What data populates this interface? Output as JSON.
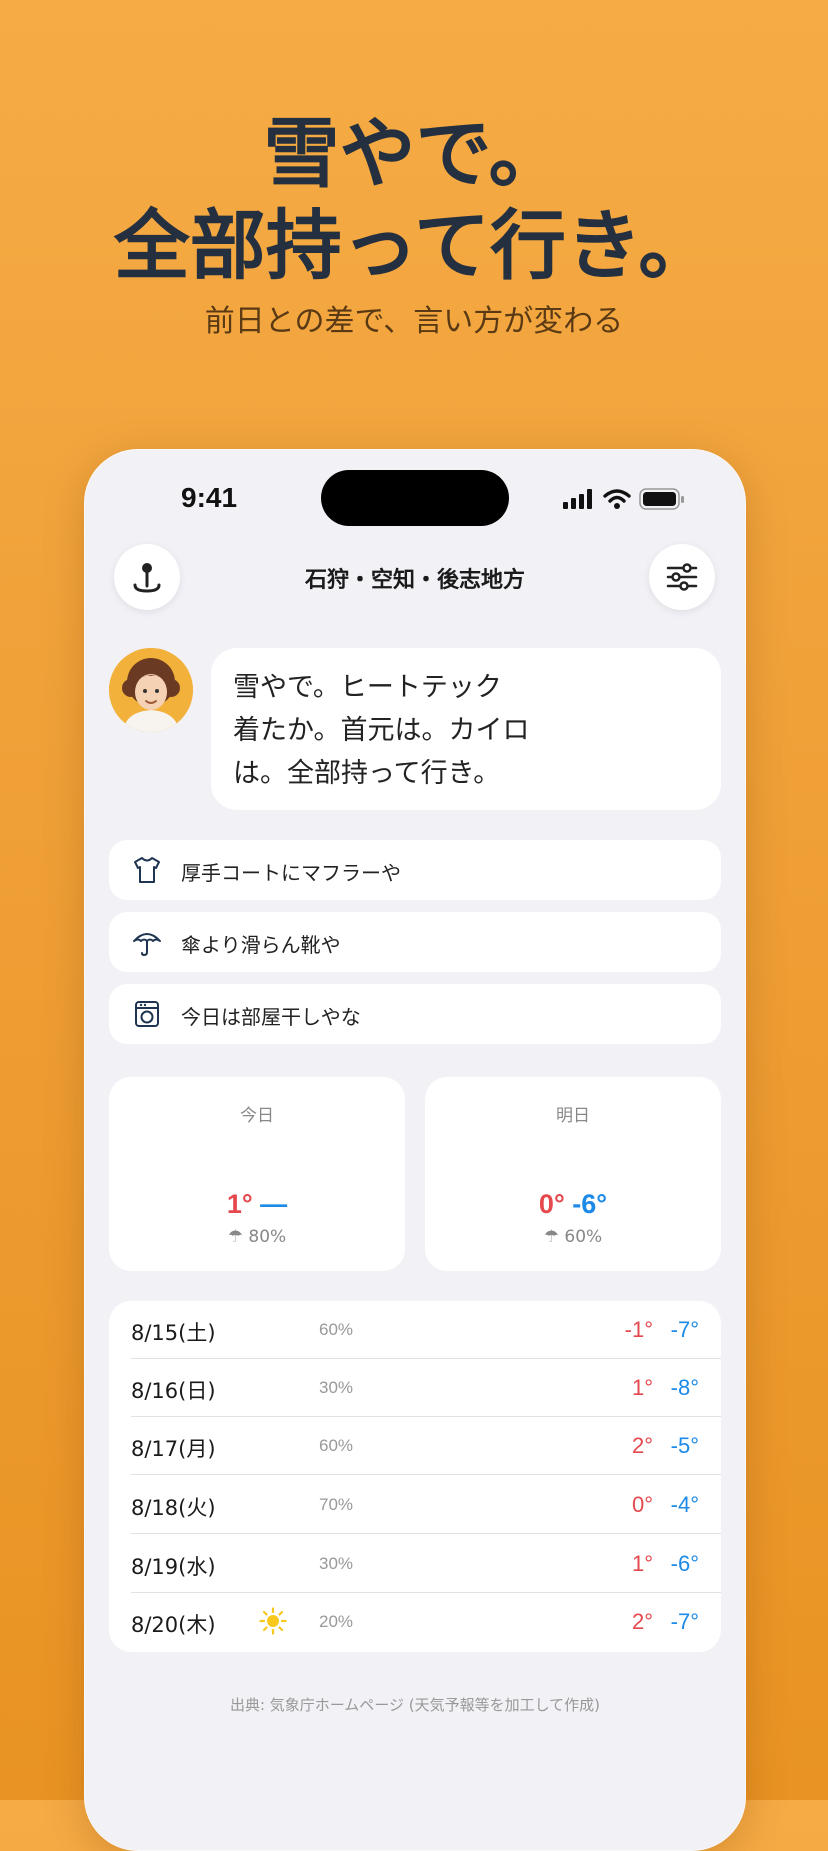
{
  "headline": {
    "line1": "雪やで。",
    "line2": "全部持って行き。",
    "subtitle": "前日との差で、言い方が変わる"
  },
  "status_bar": {
    "time": "9:41"
  },
  "header": {
    "region": "石狩・空知・後志地方",
    "left_icon": "location-pin-icon",
    "right_icon": "sliders-icon"
  },
  "message": {
    "text_lines": [
      "雪やで。ヒートテック",
      "着たか。首元は。カイロ",
      "は。全部持って行き。"
    ]
  },
  "advice": [
    {
      "icon": "shirt-icon",
      "label": "厚手コートにマフラーや"
    },
    {
      "icon": "umbrella-icon",
      "label": "傘より滑らん靴や"
    },
    {
      "icon": "laundry-icon",
      "label": "今日は部屋干しやな"
    }
  ],
  "today": {
    "label": "今日",
    "high": "1°",
    "low": "—",
    "rain": "80%",
    "rain_icon": "umbrella-emoji"
  },
  "tomorrow": {
    "label": "明日",
    "high": "0°",
    "low": "-6°",
    "rain": "60%",
    "rain_icon": "umbrella-emoji"
  },
  "forecast": [
    {
      "date": "8/15(土)",
      "pct": "60%",
      "high": "-1°",
      "low": "-7°",
      "icon": ""
    },
    {
      "date": "8/16(日)",
      "pct": "30%",
      "high": "1°",
      "low": "-8°",
      "icon": ""
    },
    {
      "date": "8/17(月)",
      "pct": "60%",
      "high": "2°",
      "low": "-5°",
      "icon": ""
    },
    {
      "date": "8/18(火)",
      "pct": "70%",
      "high": "0°",
      "low": "-4°",
      "icon": ""
    },
    {
      "date": "8/19(水)",
      "pct": "30%",
      "high": "1°",
      "low": "-6°",
      "icon": ""
    },
    {
      "date": "8/20(木)",
      "pct": "20%",
      "high": "2°",
      "low": "-7°",
      "icon": "sun-icon"
    }
  ],
  "source": "出典: 気象庁ホームページ (天気予報等を加工して作成)",
  "colors": {
    "high": "#e5484d",
    "low": "#1c8ae6",
    "background": "#f0a138"
  }
}
